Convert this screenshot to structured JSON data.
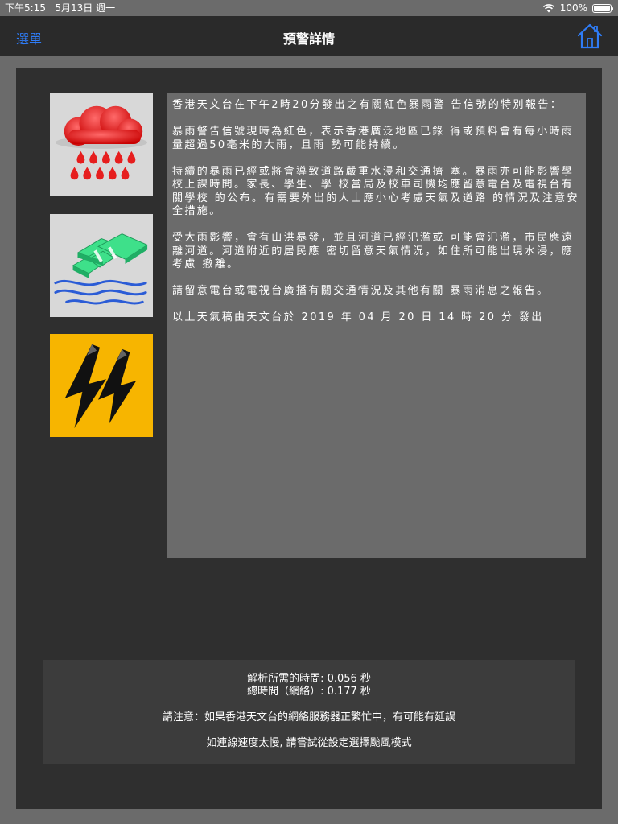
{
  "status_bar": {
    "time": "下午5:15",
    "date": "5月13日 週一",
    "battery": "100%",
    "battery_level": 1.0
  },
  "nav": {
    "menu_label": "選單",
    "title": "預警詳情",
    "home_icon": "home-icon"
  },
  "icons": {
    "rain": "rainstorm-red-icon",
    "flood": "flooding-icon",
    "thunder": "thunderstorm-icon"
  },
  "bulletin": {
    "paragraphs": [
      "香港天文台在下午2時20分發出之有關紅色暴雨警 告信號的特別報告：",
      "暴雨警告信號現時為紅色，表示香港廣泛地區已錄 得或預料會有每小時雨量超過50毫米的大雨，且雨 勢可能持續。",
      "持續的暴雨已經或將會導致道路嚴重水浸和交通擠 塞。暴雨亦可能影響學校上課時間。家長、學生、學 校當局及校車司機均應留意電台及電視台有關學校 的公布。有需要外出的人士應小心考慮天氣及道路 的情況及注意安全措施。",
      "受大雨影響，會有山洪暴發，並且河道已經氾濫或 可能會氾濫，市民應遠離河道。河道附近的居民應 密切留意天氣情況，如住所可能出現水浸，應考慮 撤離。",
      "請留意電台或電視台廣播有關交通情況及其他有關 暴雨消息之報告。",
      "以上天氣稿由天文台於 2019 年 04 月 20 日 14 時 20 分 發出"
    ]
  },
  "footer": {
    "parse_time": "解析所需的時間: 0.056 秒",
    "total_time": "總時間（網絡）:  0.177 秒",
    "notice": "請注意：如果香港天文台的網絡服務器正繁忙中，有可能有延誤",
    "slow_hint": "如連線速度太慢, 請嘗試從設定選擇颱風模式"
  },
  "colors": {
    "accent": "#2f7cf6",
    "rain_red": "#e61e1e",
    "flood_green": "#3ee08a",
    "thunder_yellow": "#f7b500"
  }
}
